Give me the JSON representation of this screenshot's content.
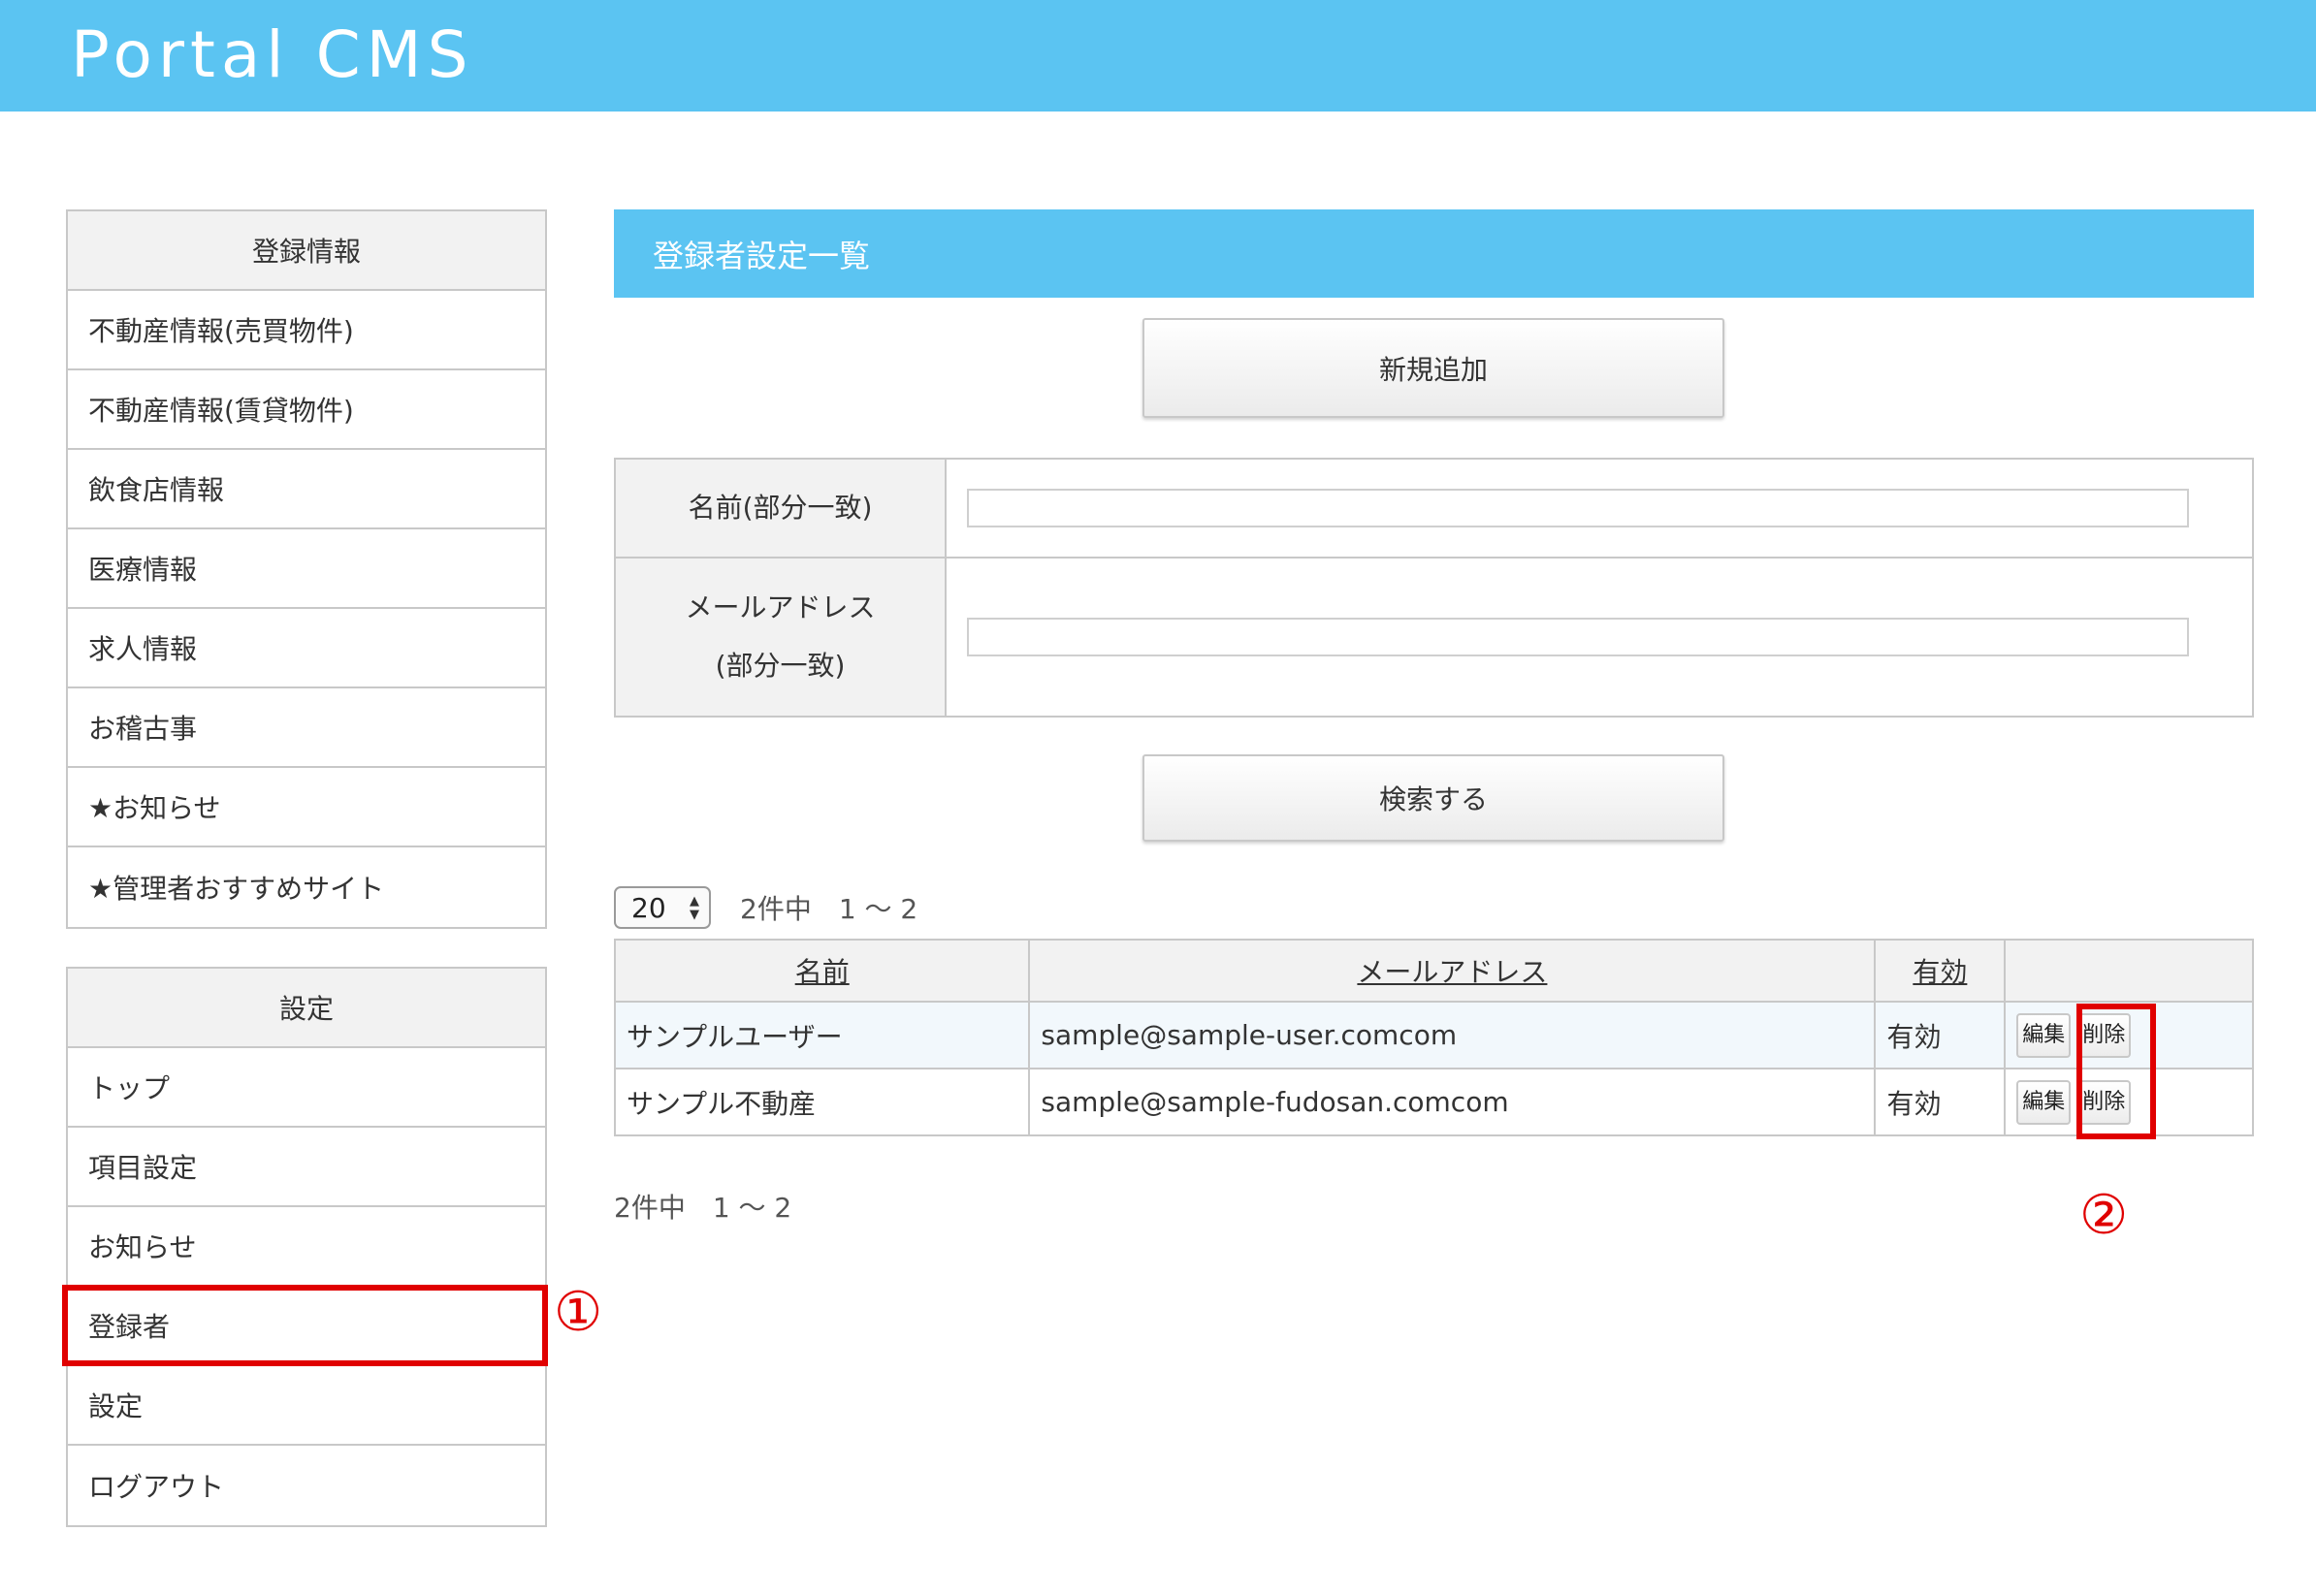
{
  "header": {
    "title": "Portal CMS"
  },
  "sidebar": {
    "section1": {
      "heading": "登録情報",
      "items": [
        "不動産情報(売買物件)",
        "不動産情報(賃貸物件)",
        "飲食店情報",
        "医療情報",
        "求人情報",
        "お稽古事",
        "★お知らせ",
        "★管理者おすすめサイト"
      ]
    },
    "section2": {
      "heading": "設定",
      "items": [
        "トップ",
        "項目設定",
        "お知らせ",
        "登録者",
        "設定",
        "ログアウト"
      ]
    }
  },
  "annotations": {
    "mark1": "①",
    "mark2": "②",
    "highlight_color": "#e00000"
  },
  "main": {
    "title": "登録者設定一覧",
    "new_button": "新規追加",
    "search": {
      "name_label": "名前(部分一致)",
      "email_label_line1": "メールアドレス",
      "email_label_line2": "(部分一致)",
      "name_value": "",
      "email_value": "",
      "submit_label": "検索する"
    },
    "pager": {
      "per_page": "20",
      "summary": "2件中　1 〜 2"
    },
    "table": {
      "headers": [
        "名前",
        "メールアドレス",
        "有効",
        ""
      ],
      "rows": [
        {
          "name": "サンプルユーザー",
          "email": "sample@sample-user.comcom",
          "status": "有効",
          "edit": "編集",
          "delete": "削除"
        },
        {
          "name": "サンプル不動産",
          "email": "sample@sample-fudosan.comcom",
          "status": "有効",
          "edit": "編集",
          "delete": "削除"
        }
      ]
    }
  },
  "colors": {
    "accent": "#5bc4f2",
    "border": "#c8c8c8",
    "header_bg": "#f2f2f2"
  }
}
